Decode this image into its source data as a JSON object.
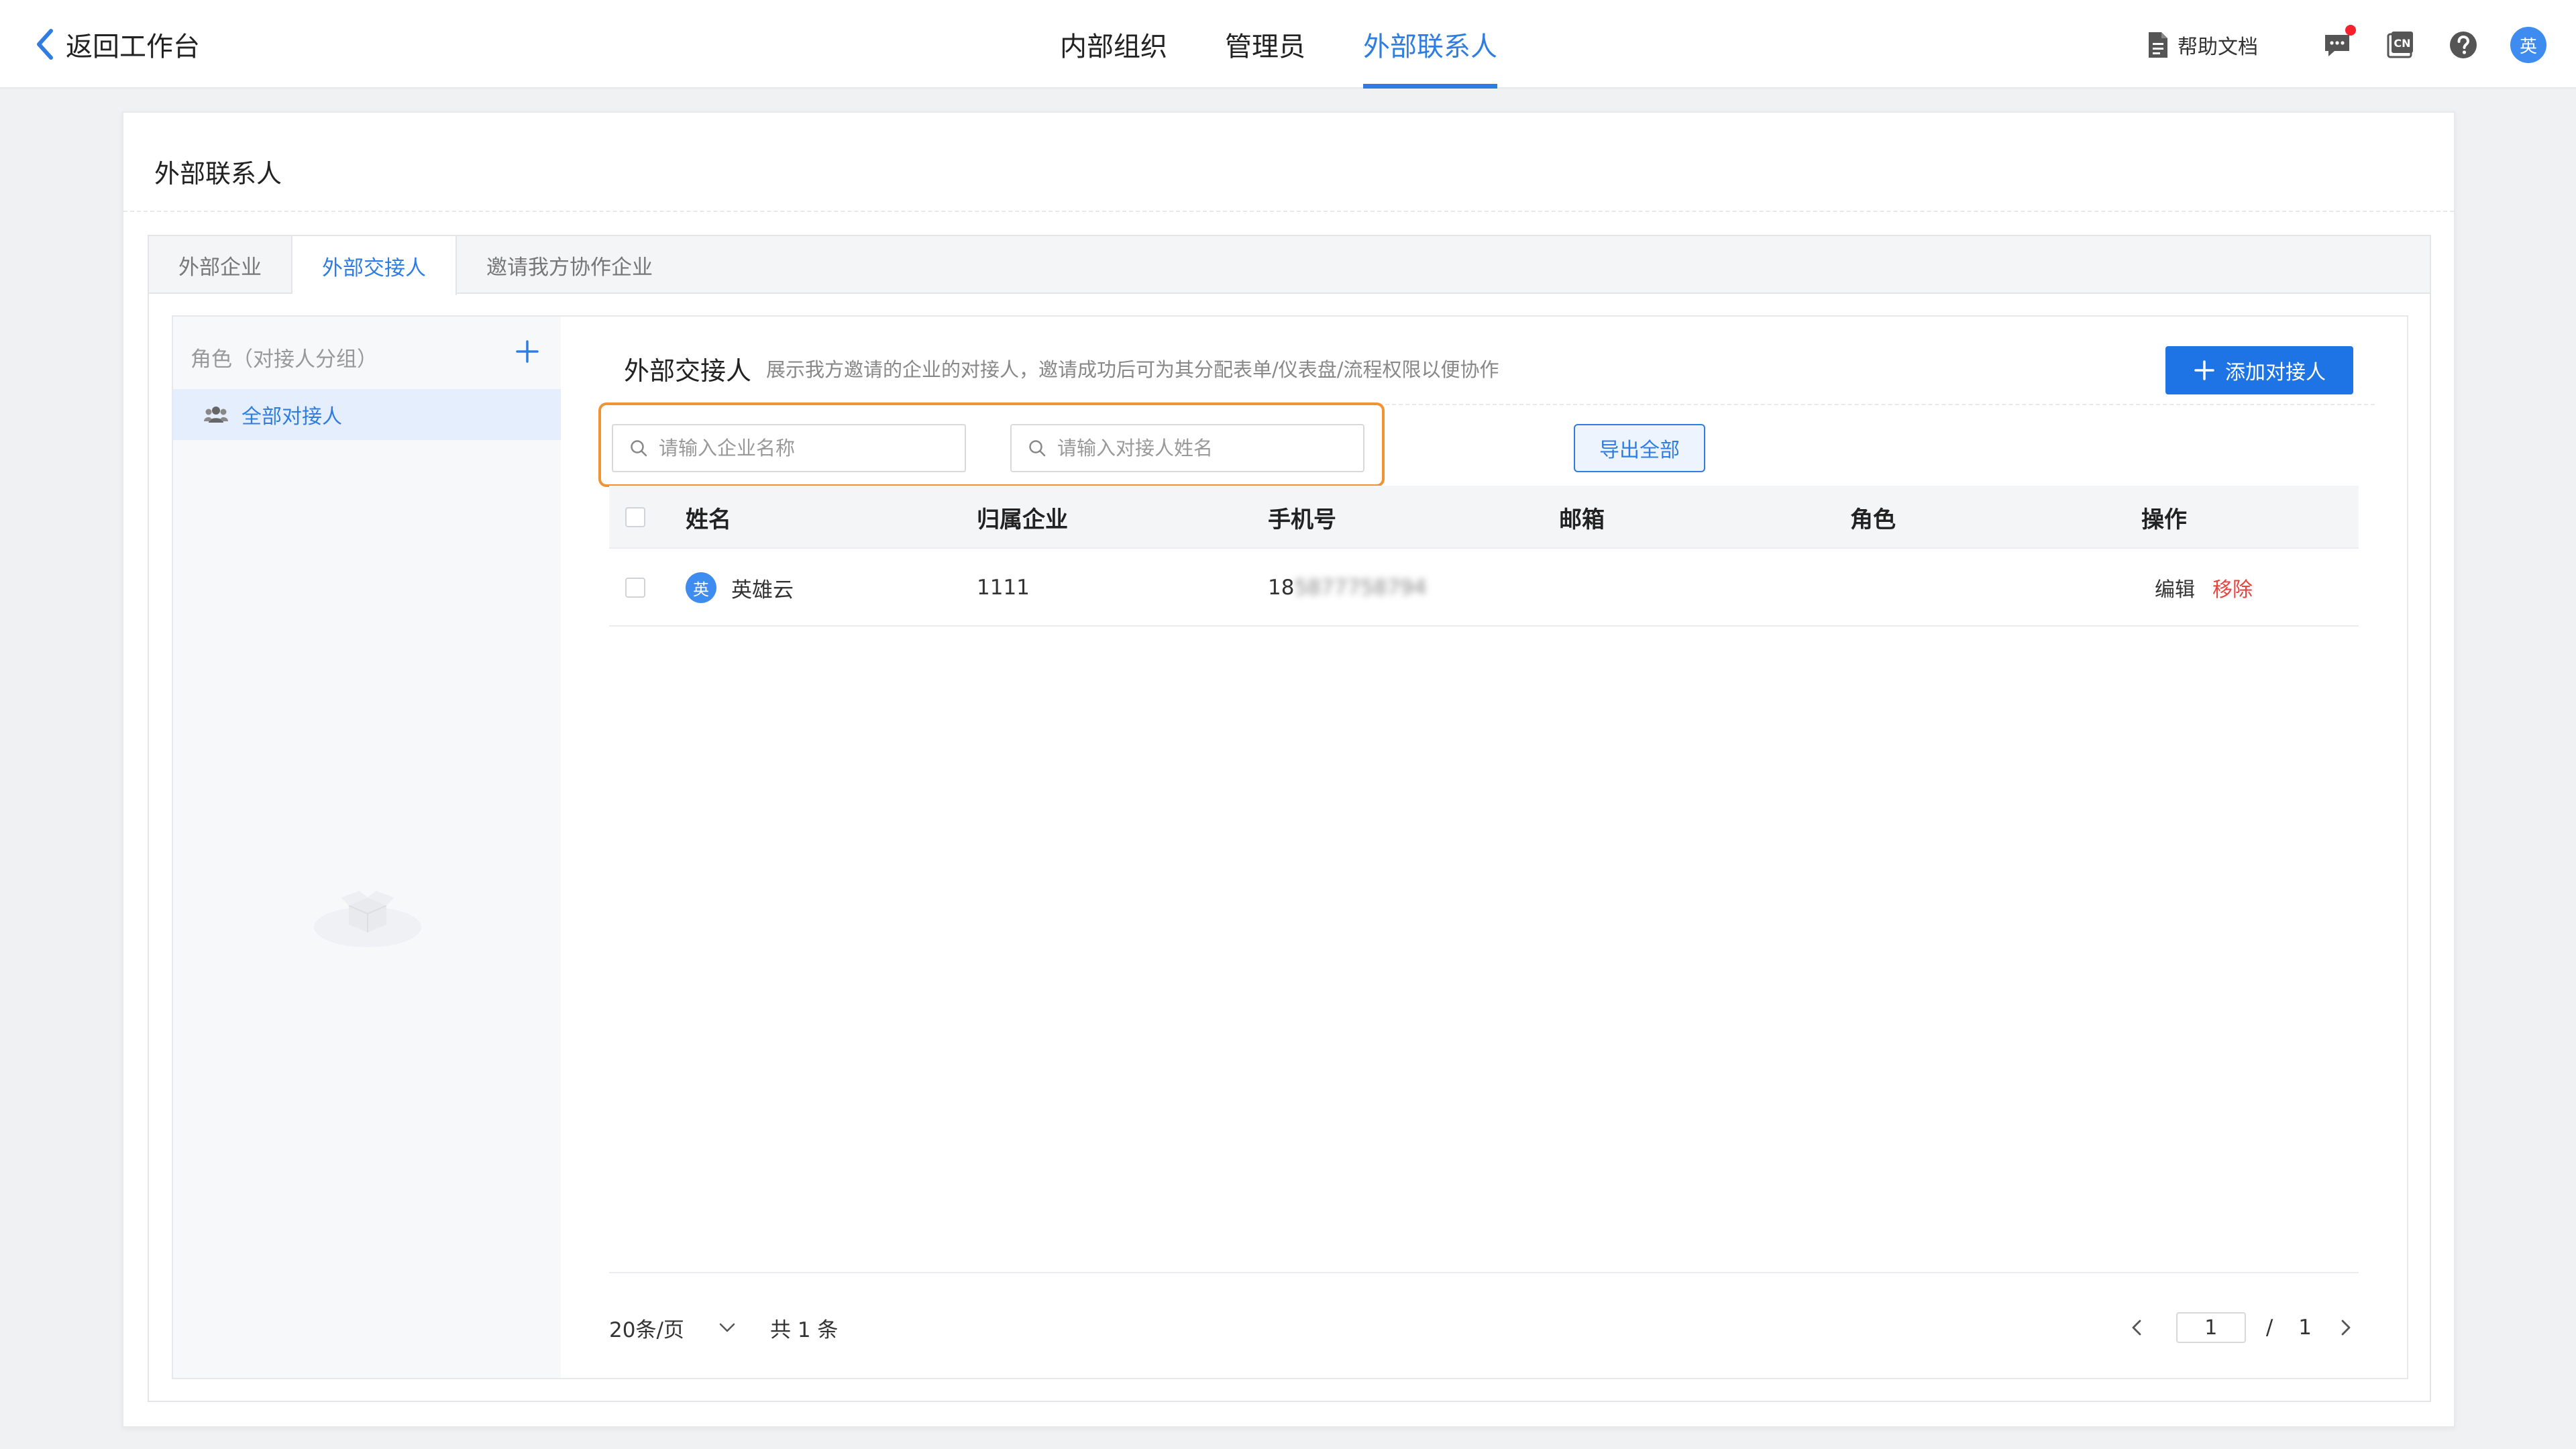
{
  "topbar": {
    "back_label": "返回工作台",
    "nav": [
      {
        "label": "内部组织",
        "active": false
      },
      {
        "label": "管理员",
        "active": false
      },
      {
        "label": "外部联系人",
        "active": true
      }
    ],
    "help_label": "帮助文档",
    "avatar_text": "英"
  },
  "page": {
    "title": "外部联系人",
    "tabs": [
      {
        "label": "外部企业"
      },
      {
        "label": "外部交接人"
      },
      {
        "label": "邀请我方协作企业"
      }
    ]
  },
  "sidebar": {
    "header": "角色（对接人分组）",
    "items": [
      {
        "label": "全部对接人"
      }
    ]
  },
  "content": {
    "title": "外部交接人",
    "description": "展示我方邀请的企业的对接人，邀请成功后可为其分配表单/仪表盘/流程权限以便协作",
    "add_button": "添加对接人",
    "search_company_placeholder": "请输入企业名称",
    "search_contact_placeholder": "请输入对接人姓名",
    "export_button": "导出全部"
  },
  "table": {
    "columns": [
      "姓名",
      "归属企业",
      "手机号",
      "邮箱",
      "角色",
      "操作"
    ],
    "rows": [
      {
        "avatar": "英",
        "name": "英雄云",
        "company": "1111",
        "phone_prefix": "18",
        "phone_hidden": "5877758794",
        "email": "",
        "role": "",
        "edit": "编辑",
        "remove": "移除"
      }
    ]
  },
  "pagination": {
    "page_size": "20条/页",
    "total": "共 1 条",
    "current": "1",
    "separator": "/",
    "pages": "1"
  },
  "colors": {
    "accent": "#2f7de1",
    "button": "#1f74e5",
    "danger": "#e8433e",
    "highlight": "#f09433"
  }
}
